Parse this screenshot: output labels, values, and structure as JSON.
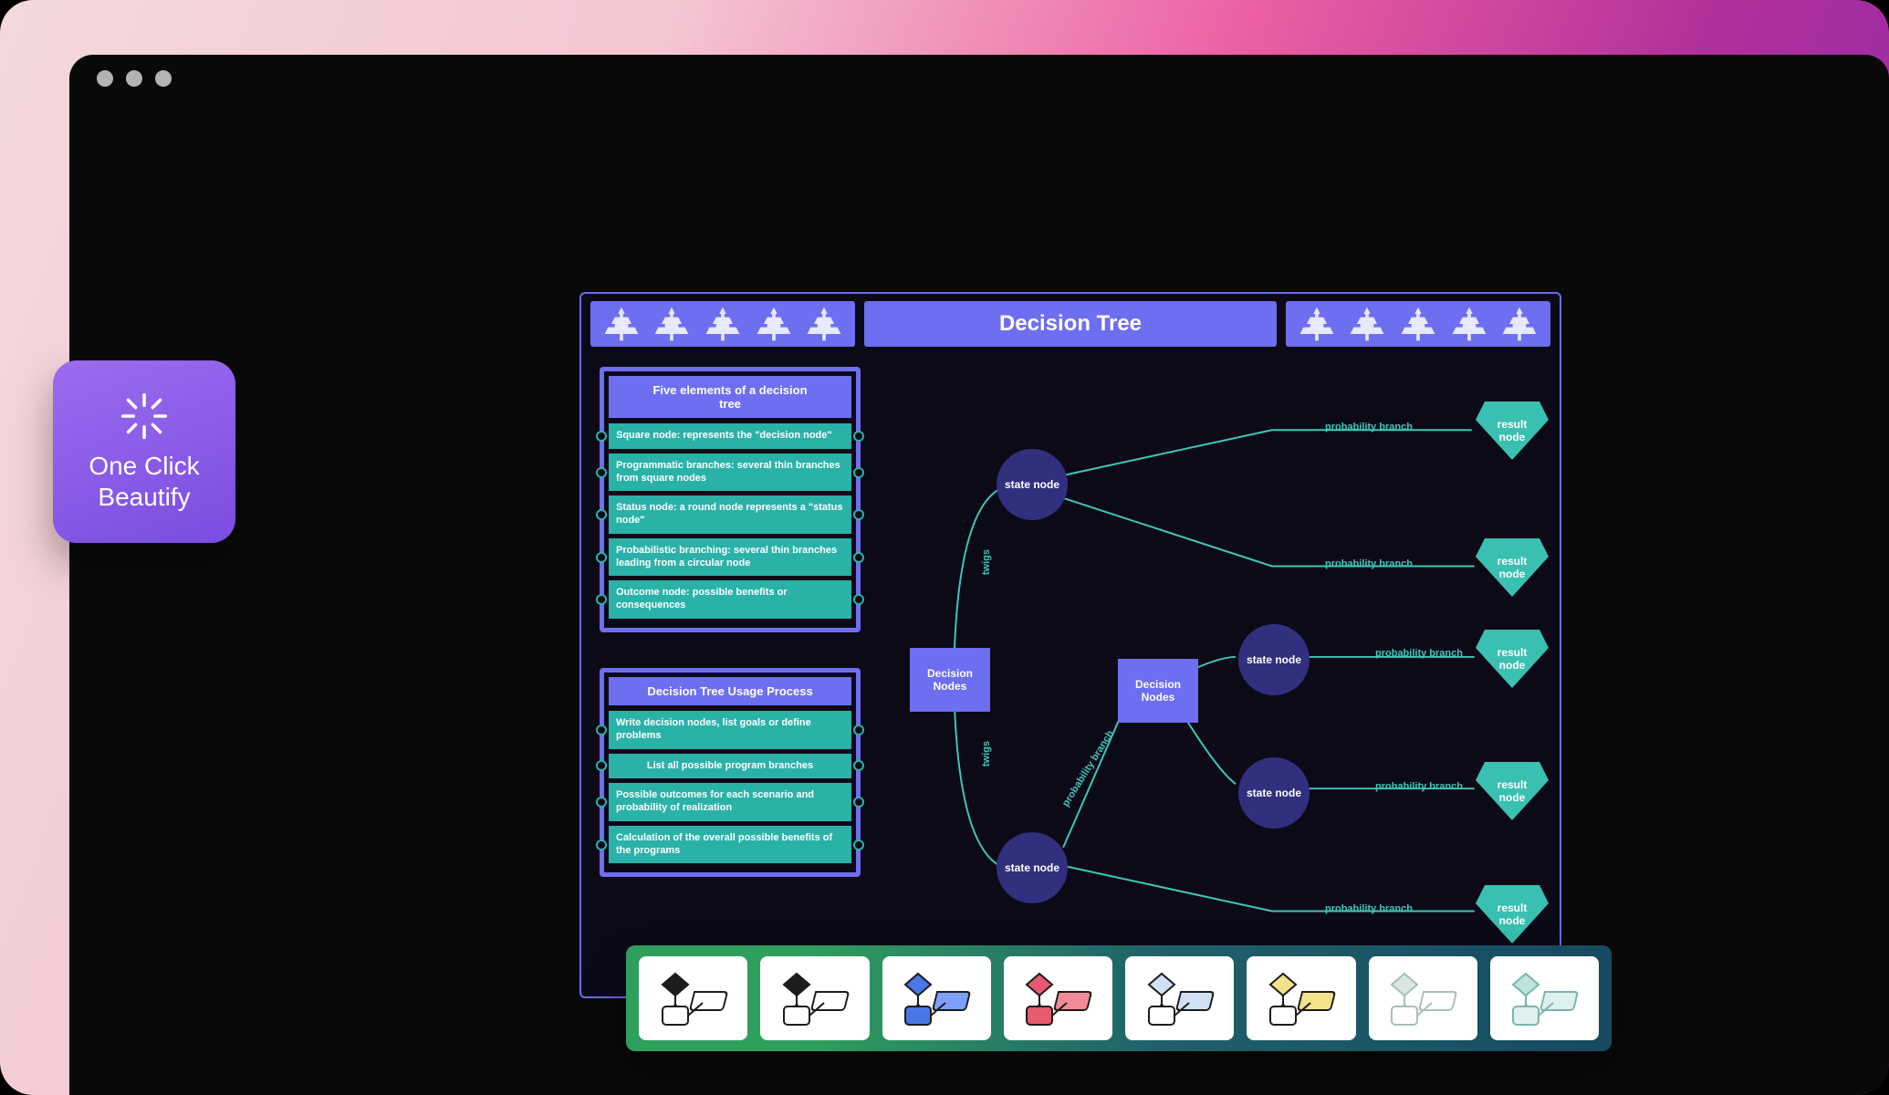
{
  "app": {
    "title": "One Click\nBeautify"
  },
  "colors": {
    "accent": "#6e6ef0",
    "teal": "#2ab2a8",
    "node_circle": "#30307e",
    "result": "#3ac0b0"
  },
  "canvas": {
    "title": "Decision Tree",
    "tree_icon": "tree-icon",
    "panel1": {
      "header": "Five elements of a decision\ntree",
      "rows": [
        "Square node: represents the  \"decision node\"",
        "Programmatic branches: several thin branches from square nodes",
        "Status node: a round node represents a \"status node\"",
        "Probabilistic branching: several thin branches leading from a circular node",
        "Outcome node: possible benefits or consequences"
      ]
    },
    "panel2": {
      "header": "Decision Tree Usage Process",
      "rows": [
        "Write decision nodes, list goals or define problems",
        "List all possible program branches",
        "Possible outcomes for each scenario and probability of realization",
        "Calculation of the overall possible benefits of the programs"
      ]
    },
    "nodes": {
      "decision1": "Decision\nNodes",
      "decision2": "Decision\nNodes",
      "state": "state node",
      "result": "result\nnode"
    },
    "labels": {
      "twigs": "twigs",
      "prob_branch": "probability branch"
    }
  },
  "palette": [
    {
      "name": "style-outline-black",
      "d": "#1c1c1c",
      "s": "#ffffff",
      "r": "#ffffff",
      "stroke": "#1c1c1c"
    },
    {
      "name": "style-outline-black-2",
      "d": "#1c1c1c",
      "s": "#ffffff",
      "r": "#ffffff",
      "stroke": "#1c1c1c"
    },
    {
      "name": "style-blue",
      "d": "#4a77e6",
      "s": "#4a77e6",
      "r": "#7da0ff",
      "stroke": "#1c1c1c"
    },
    {
      "name": "style-red",
      "d": "#e85a6d",
      "s": "#e85a6d",
      "r": "#f48a97",
      "stroke": "#1c1c1c"
    },
    {
      "name": "style-lightblue",
      "d": "#cfe1f2",
      "s": "#ffffff",
      "r": "#cfe1f2",
      "stroke": "#1c1c1c"
    },
    {
      "name": "style-yellow",
      "d": "#f2e38a",
      "s": "#ffffff",
      "r": "#f2e38a",
      "stroke": "#1c1c1c"
    },
    {
      "name": "style-pale",
      "d": "#d8e7e4",
      "s": "#ffffff",
      "r": "#ffffff",
      "stroke": "#a9bfbb"
    },
    {
      "name": "style-teal",
      "d": "#bfe3df",
      "s": "#dff1ef",
      "r": "#dff1ef",
      "stroke": "#7bb5af"
    }
  ]
}
